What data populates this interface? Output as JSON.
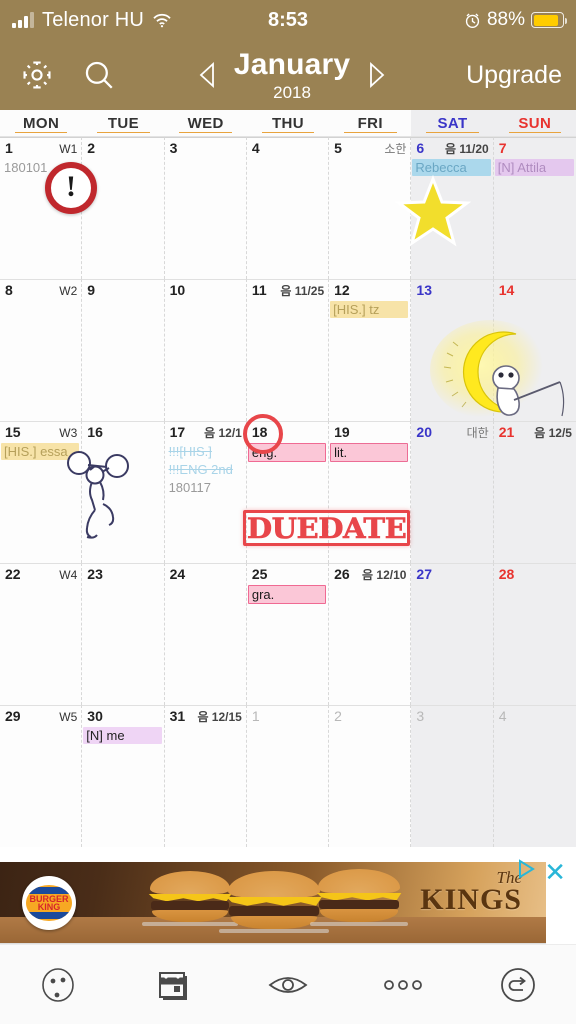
{
  "status_bar": {
    "carrier": "Telenor HU",
    "time": "8:53",
    "battery_percent": "88%",
    "signal_icon": "signal-bars-icon",
    "wifi_icon": "wifi-icon",
    "alarm_icon": "alarm-clock-icon",
    "battery_icon": "battery-icon",
    "battery_color": "#ffcc00",
    "background_color": "#9a8253"
  },
  "app_bar": {
    "settings_icon": "gear-icon",
    "search_icon": "search-icon",
    "prev_icon": "chevron-left-icon",
    "next_icon": "chevron-right-icon",
    "month": "January",
    "year": "2018",
    "upgrade_label": "Upgrade",
    "background_color": "#9a8253"
  },
  "weekday_header": [
    {
      "label": "MON",
      "type": "weekday"
    },
    {
      "label": "TUE",
      "type": "weekday"
    },
    {
      "label": "WED",
      "type": "weekday"
    },
    {
      "label": "THU",
      "type": "weekday"
    },
    {
      "label": "FRI",
      "type": "weekday"
    },
    {
      "label": "SAT",
      "type": "saturday"
    },
    {
      "label": "SUN",
      "type": "sunday"
    }
  ],
  "calendar": {
    "cells": [
      {
        "day": "1",
        "sub": "W1",
        "sub_kind": "week",
        "kind": "mon",
        "events": [
          {
            "text": "180101",
            "style": "plain"
          }
        ]
      },
      {
        "day": "2",
        "sub": "",
        "sub_kind": "",
        "kind": "day",
        "events": []
      },
      {
        "day": "3",
        "sub": "",
        "sub_kind": "",
        "kind": "day",
        "events": []
      },
      {
        "day": "4",
        "sub": "",
        "sub_kind": "",
        "kind": "day",
        "events": []
      },
      {
        "day": "5",
        "sub": "소한",
        "sub_kind": "holi",
        "kind": "day",
        "events": []
      },
      {
        "day": "6",
        "sub": "음 11/20",
        "sub_kind": "lunar",
        "kind": "sat",
        "events": [
          {
            "text": "Rebecca",
            "style": "blue"
          }
        ]
      },
      {
        "day": "7",
        "sub": "",
        "sub_kind": "",
        "kind": "sun",
        "events": [
          {
            "text": "[N] Attila",
            "style": "purple"
          }
        ]
      },
      {
        "day": "8",
        "sub": "W2",
        "sub_kind": "week",
        "kind": "mon",
        "events": []
      },
      {
        "day": "9",
        "sub": "",
        "sub_kind": "",
        "kind": "day",
        "events": []
      },
      {
        "day": "10",
        "sub": "",
        "sub_kind": "",
        "kind": "day",
        "events": []
      },
      {
        "day": "11",
        "sub": "음 11/25",
        "sub_kind": "lunar",
        "kind": "day",
        "events": []
      },
      {
        "day": "12",
        "sub": "",
        "sub_kind": "",
        "kind": "day",
        "events": [
          {
            "text": "[HIS.] tz",
            "style": "yellow"
          }
        ]
      },
      {
        "day": "13",
        "sub": "",
        "sub_kind": "",
        "kind": "sat",
        "events": []
      },
      {
        "day": "14",
        "sub": "",
        "sub_kind": "",
        "kind": "sun",
        "events": []
      },
      {
        "day": "15",
        "sub": "W3",
        "sub_kind": "week",
        "kind": "mon",
        "events": [
          {
            "text": "[HIS.] essa",
            "style": "yellow"
          }
        ]
      },
      {
        "day": "16",
        "sub": "",
        "sub_kind": "",
        "kind": "day",
        "events": []
      },
      {
        "day": "17",
        "sub": "음 12/1",
        "sub_kind": "lunar",
        "kind": "day",
        "events": [
          {
            "text": "!!![HIS.]",
            "style": "strike"
          },
          {
            "text": "!!!ENG 2nd",
            "style": "strike"
          },
          {
            "text": "180117",
            "style": "plain"
          }
        ]
      },
      {
        "day": "18",
        "sub": "",
        "sub_kind": "",
        "kind": "day",
        "events": [
          {
            "text": "eng.",
            "style": "pink"
          }
        ]
      },
      {
        "day": "19",
        "sub": "",
        "sub_kind": "",
        "kind": "day",
        "events": [
          {
            "text": "lit.",
            "style": "pink2"
          }
        ]
      },
      {
        "day": "20",
        "sub": "대한",
        "sub_kind": "holi",
        "kind": "sat",
        "events": []
      },
      {
        "day": "21",
        "sub": "음 12/5",
        "sub_kind": "lunar",
        "kind": "sun",
        "events": []
      },
      {
        "day": "22",
        "sub": "W4",
        "sub_kind": "week",
        "kind": "mon",
        "events": []
      },
      {
        "day": "23",
        "sub": "",
        "sub_kind": "",
        "kind": "day",
        "events": []
      },
      {
        "day": "24",
        "sub": "",
        "sub_kind": "",
        "kind": "day",
        "events": []
      },
      {
        "day": "25",
        "sub": "",
        "sub_kind": "",
        "kind": "day",
        "events": [
          {
            "text": "gra.",
            "style": "pink"
          }
        ]
      },
      {
        "day": "26",
        "sub": "음 12/10",
        "sub_kind": "lunar",
        "kind": "day",
        "events": []
      },
      {
        "day": "27",
        "sub": "",
        "sub_kind": "",
        "kind": "sat",
        "events": []
      },
      {
        "day": "28",
        "sub": "",
        "sub_kind": "",
        "kind": "sun",
        "events": []
      },
      {
        "day": "29",
        "sub": "W5",
        "sub_kind": "week",
        "kind": "mon",
        "events": []
      },
      {
        "day": "30",
        "sub": "",
        "sub_kind": "",
        "kind": "day",
        "events": [
          {
            "text": "[N] me",
            "style": "purple-solid"
          }
        ]
      },
      {
        "day": "31",
        "sub": "음 12/15",
        "sub_kind": "lunar",
        "kind": "day",
        "events": []
      },
      {
        "day": "1",
        "sub": "",
        "sub_kind": "",
        "kind": "out",
        "events": []
      },
      {
        "day": "2",
        "sub": "",
        "sub_kind": "",
        "kind": "out",
        "events": []
      },
      {
        "day": "3",
        "sub": "",
        "sub_kind": "",
        "kind": "out-sat",
        "events": []
      },
      {
        "day": "4",
        "sub": "",
        "sub_kind": "",
        "kind": "out-sun",
        "events": []
      }
    ]
  },
  "stickers": [
    {
      "name": "exclamation-circle-sticker",
      "text": "!"
    },
    {
      "name": "yellow-star-sticker"
    },
    {
      "name": "moon-fishing-sticker"
    },
    {
      "name": "weightlifter-sticker"
    },
    {
      "name": "red-circle-highlight-sticker"
    },
    {
      "name": "duedate-stamp-sticker",
      "text": "DUEDATE"
    }
  ],
  "advertisement": {
    "brand": "BURGER KING",
    "logo_line1": "BURGER",
    "logo_line2": "KING",
    "headline_small": "The",
    "headline_large": "KINGS",
    "info_icon": "ad-choices-icon",
    "close_icon": "close-icon",
    "control_color": "#29b6d8"
  },
  "toolbar": [
    {
      "name": "sticker-face-button",
      "icon": "smiley-face-icon"
    },
    {
      "name": "calendar-view-button",
      "icon": "calendar-icon"
    },
    {
      "name": "preview-button",
      "icon": "eye-icon"
    },
    {
      "name": "more-options-button",
      "icon": "more-dots-icon"
    },
    {
      "name": "undo-button",
      "icon": "undo-icon"
    }
  ]
}
